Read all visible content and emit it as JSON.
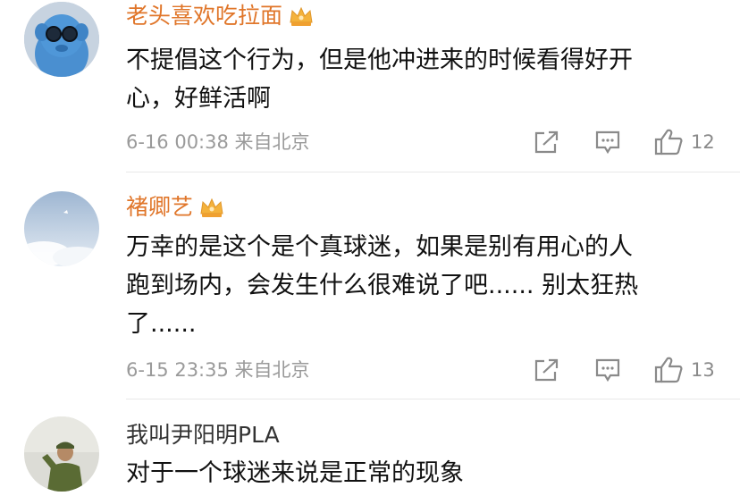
{
  "comments": [
    {
      "username": "老头喜欢吃拉面",
      "vip": true,
      "lines": [
        "不提倡这个行为，但是他冲进来的时候看得好开",
        "心，好鲜活啊"
      ],
      "meta": "6-16 00:38 来自北京",
      "likes": "12"
    },
    {
      "username": "褚卿艺",
      "vip": true,
      "lines": [
        "万幸的是这个是个真球迷，如果是别有用心的人",
        "跑到场内，会发生什么很难说了吧...... 别太狂热",
        "了......"
      ],
      "meta": "6-15 23:35 来自北京",
      "likes": "13"
    },
    {
      "username": "我叫尹阳明PLA",
      "vip": false,
      "lines": [
        "对于一个球迷来说是正常的现象"
      ],
      "meta": "",
      "likes": ""
    }
  ],
  "colors": {
    "vip_name": "#e0762a",
    "normal_name": "#333333",
    "meta": "#9a9a9a",
    "icon": "#8a8a8a",
    "crown": "#f4b23c"
  },
  "icons": [
    "crown-icon",
    "share-icon",
    "comment-icon",
    "thumbs-up-icon"
  ]
}
